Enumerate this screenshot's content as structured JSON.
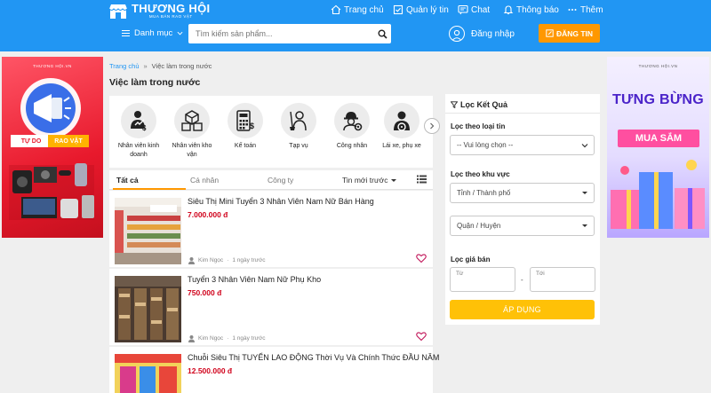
{
  "header": {
    "logo_title": "THƯƠNG HỘI",
    "logo_sub": "MUA BÁN RAO VẶT",
    "nav": [
      {
        "label": "Trang chủ",
        "icon": "home-icon"
      },
      {
        "label": "Quản lý tin",
        "icon": "manage-icon"
      },
      {
        "label": "Chat",
        "icon": "chat-icon"
      },
      {
        "label": "Thông báo",
        "icon": "bell-icon"
      },
      {
        "label": "Thêm",
        "icon": "more-icon"
      }
    ],
    "category_label": "Danh mục",
    "search_placeholder": "Tìm kiếm sản phẩm...",
    "login_label": "Đăng nhập",
    "post_label": "ĐĂNG TIN"
  },
  "banners": {
    "left": {
      "brand": "THƯƠNG HỘI.VN",
      "tag1": "TỰ DO",
      "tag2": "RAO VẶT"
    },
    "right": {
      "brand": "THƯƠNG HỘI.VN",
      "line1": "TƯNG BỪNG",
      "line2": "MUA SẮM"
    }
  },
  "breadcrumb": {
    "home": "Trang chủ",
    "sep": "»",
    "current": "Việc làm trong nước"
  },
  "page_title": "Việc làm trong nước",
  "categories": [
    {
      "line1": "Nhân viên kinh",
      "line2": "doanh",
      "icon": "sales-icon"
    },
    {
      "line1": "Nhân viên kho",
      "line2": "vận",
      "icon": "warehouse-boxes-icon"
    },
    {
      "line1": "Kế toán",
      "line2": "",
      "icon": "calculator-icon"
    },
    {
      "line1": "Tạp vụ",
      "line2": "",
      "icon": "cleaner-icon"
    },
    {
      "line1": "Công nhân",
      "line2": "",
      "icon": "worker-icon"
    },
    {
      "line1": "Lái xe, phụ xe",
      "line2": "",
      "icon": "driver-icon"
    }
  ],
  "tabs": {
    "all": "Tất cả",
    "personal": "Cá nhân",
    "company": "Công ty",
    "sort": "Tin mới trước"
  },
  "listings": [
    {
      "title": "Siêu Thị Mini Tuyển 3 Nhân Viên Nam Nữ Bán Hàng",
      "price": "7.000.000 đ",
      "user": "Kim Ngọc",
      "time": "1 ngày trước"
    },
    {
      "title": "Tuyển 3 Nhân Viên Nam Nữ Phụ Kho",
      "price": "750.000 đ",
      "user": "Kim Ngọc",
      "time": "1 ngày trước"
    },
    {
      "title": "Chuỗi Siêu Thị TUYỂN LAO ĐỘNG Thời Vụ Và Chính Thức ĐẦU NĂM",
      "price": "12.500.000 đ",
      "user": "",
      "time": ""
    }
  ],
  "filter": {
    "heading": "Lọc Kết Quả",
    "type_label": "Lọc theo loại tin",
    "type_value": "-- Vui lòng chọn --",
    "area_label": "Lọc theo khu vực",
    "province": "Tỉnh / Thành phố",
    "district": "Quận / Huyện",
    "price_label": "Lọc giá bán",
    "from": "Từ",
    "to": "Tới",
    "dash": "-",
    "apply": "ÁP DỤNG"
  },
  "colors": {
    "header": "#2196f3",
    "accent": "#ff9800",
    "price": "#d0021b",
    "apply": "#ffc107"
  }
}
